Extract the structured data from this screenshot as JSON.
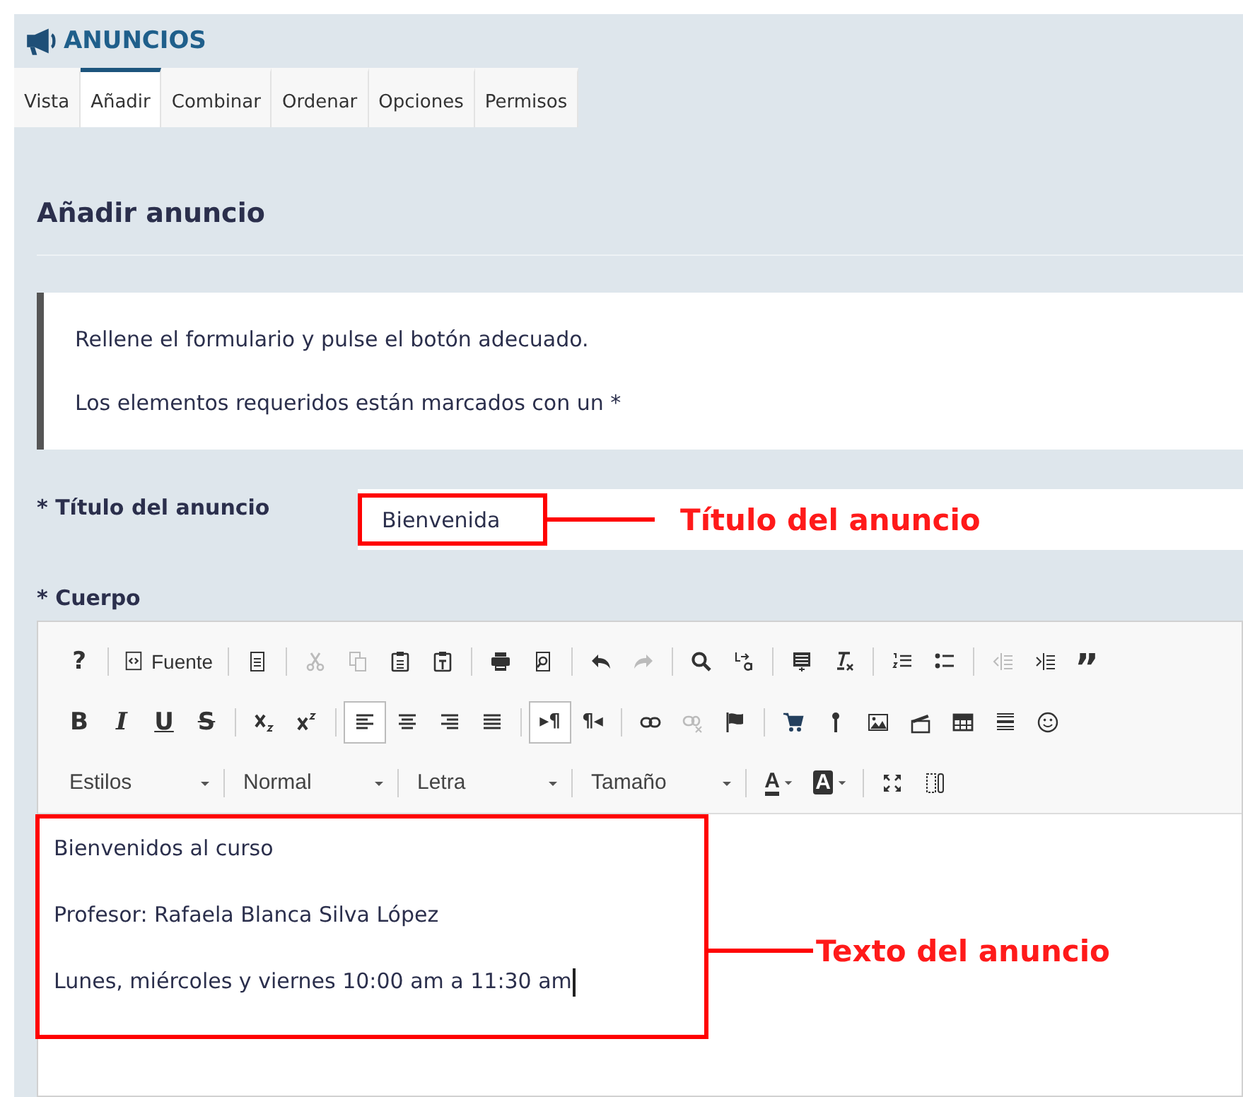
{
  "module": {
    "title": "ANUNCIOS"
  },
  "tabs": [
    {
      "label": "Vista",
      "selected": false
    },
    {
      "label": "Añadir",
      "selected": true
    },
    {
      "label": "Combinar",
      "selected": false
    },
    {
      "label": "Ordenar",
      "selected": false
    },
    {
      "label": "Opciones",
      "selected": false
    },
    {
      "label": "Permisos",
      "selected": false
    }
  ],
  "page_title": "Añadir anuncio",
  "instructions": [
    "Rellene el formulario y pulse el botón adecuado.",
    "Los elementos requeridos están marcados con un *"
  ],
  "title_field": {
    "label": "* Título del anuncio",
    "value": "Bienvenida",
    "annotation": "Título del anuncio"
  },
  "body_field": {
    "label": "* Cuerpo",
    "annotation": "Texto del anuncio",
    "toolbar": [
      [
        [
          {
            "kind": "glyph",
            "label": "?"
          }
        ],
        [
          {
            "kind": "button",
            "label": "Fuente"
          }
        ],
        [
          {
            "kind": "icon",
            "disabled": false
          }
        ],
        [
          {
            "kind": "icon",
            "disabled": true
          },
          {
            "kind": "icon",
            "disabled": true
          },
          {
            "kind": "icon",
            "disabled": false
          },
          {
            "kind": "icon",
            "disabled": false
          }
        ],
        [
          {
            "kind": "icon",
            "disabled": false
          },
          {
            "kind": "icon",
            "disabled": false
          }
        ],
        [
          {
            "kind": "icon",
            "disabled": false
          },
          {
            "kind": "icon",
            "disabled": true
          }
        ],
        [
          {
            "kind": "icon",
            "disabled": false
          },
          {
            "kind": "icon",
            "disabled": false
          }
        ],
        [
          {
            "kind": "icon",
            "disabled": false
          },
          {
            "kind": "icon",
            "disabled": false
          }
        ],
        [
          {
            "kind": "icon",
            "disabled": false
          },
          {
            "kind": "icon",
            "disabled": false
          }
        ],
        [
          {
            "kind": "icon",
            "disabled": true
          },
          {
            "kind": "icon",
            "disabled": false
          },
          {
            "kind": "glyph",
            "label": "”"
          }
        ]
      ],
      [
        [
          {
            "kind": "glyph",
            "label": "B"
          },
          {
            "kind": "glyph",
            "label": "I"
          },
          {
            "kind": "glyph",
            "label": "U"
          },
          {
            "kind": "glyph",
            "label": "S"
          }
        ],
        [
          {
            "kind": "icon",
            "disabled": false
          },
          {
            "kind": "icon",
            "disabled": false
          }
        ],
        [
          {
            "kind": "icon",
            "disabled": false,
            "selected": true
          },
          {
            "kind": "icon",
            "disabled": false,
            "selected": false
          },
          {
            "kind": "icon",
            "disabled": false,
            "selected": false
          },
          {
            "kind": "icon",
            "disabled": false,
            "selected": false
          }
        ],
        [
          {
            "kind": "glyph",
            "label": "▸¶",
            "selected": true
          },
          {
            "kind": "glyph",
            "label": "¶◂",
            "selected": false
          }
        ],
        [
          {
            "kind": "icon",
            "disabled": false
          },
          {
            "kind": "icon",
            "disabled": true
          },
          {
            "kind": "icon",
            "disabled": false
          }
        ],
        [
          {
            "kind": "icon",
            "disabled": false
          },
          {
            "kind": "icon",
            "disabled": false
          },
          {
            "kind": "icon",
            "disabled": false
          },
          {
            "kind": "icon",
            "disabled": false
          },
          {
            "kind": "icon",
            "disabled": false
          },
          {
            "kind": "icon",
            "disabled": false
          },
          {
            "kind": "icon",
            "disabled": false
          }
        ]
      ],
      [
        [
          {
            "kind": "dropdown",
            "label": "Estilos"
          }
        ],
        [
          {
            "kind": "dropdown",
            "label": "Normal"
          }
        ],
        [
          {
            "kind": "dropdown",
            "label": "Letra"
          }
        ],
        [
          {
            "kind": "dropdown",
            "label": "Tamaño"
          }
        ],
        [
          {
            "kind": "color",
            "label": "A"
          },
          {
            "kind": "color",
            "label": "A"
          }
        ],
        [
          {
            "kind": "icon",
            "disabled": false
          },
          {
            "kind": "icon",
            "disabled": false
          }
        ]
      ]
    ],
    "content": [
      "Bienvenidos al curso",
      "Profesor: Rafaela Blanca Silva López",
      "Lunes, miércoles y viernes 10:00 am a 11:30 am"
    ]
  }
}
